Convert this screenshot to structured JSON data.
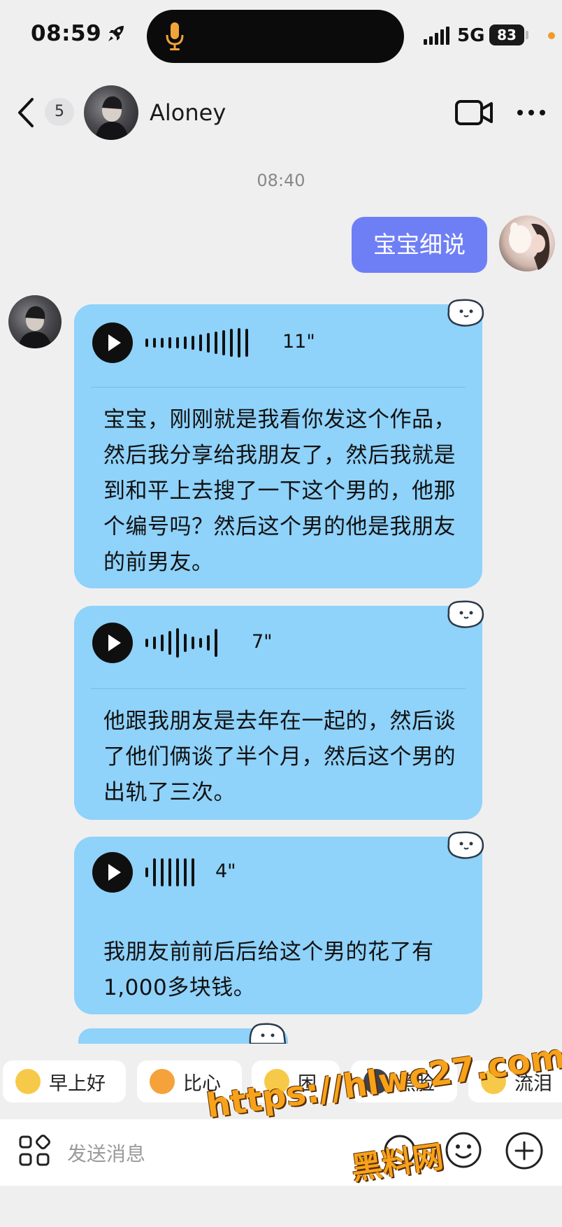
{
  "status_bar": {
    "time": "08:59",
    "network": "5G",
    "battery": "83",
    "icons": [
      "rocket-icon",
      "microphone-icon",
      "signal-icon"
    ]
  },
  "header": {
    "unread_count": "5",
    "contact_name": "Aloney",
    "icons": [
      "back-chevron-icon",
      "video-call-icon",
      "more-icon"
    ]
  },
  "conversation": {
    "timestamp": "08:40",
    "sent_message": "宝宝细说",
    "voice_messages": [
      {
        "duration": "11\"",
        "transcript": "宝宝，刚刚就是我看你发这个作品，然后我分享给我朋友了，然后我就是到和平上去搜了一下这个男的，他那个编号吗？然后这个男的他是我朋友的前男友。"
      },
      {
        "duration": "7\"",
        "transcript": "他跟我朋友是去年在一起的，然后谈了他们俩谈了半个月，然后这个男的出轨了三次。"
      },
      {
        "duration": "4\"",
        "transcript": "我朋友前前后后给这个男的花了有1,000多块钱。"
      }
    ]
  },
  "quick_replies": [
    {
      "label": "早上好",
      "icon": "sun-face-icon"
    },
    {
      "label": "比心",
      "icon": "heart-hands-icon"
    },
    {
      "label": "困",
      "icon": "sleepy-face-icon"
    },
    {
      "label": "黑脸",
      "icon": "dark-face-icon"
    },
    {
      "label": "流泪",
      "icon": "crying-face-icon"
    }
  ],
  "input_bar": {
    "placeholder": "发送消息",
    "icons": [
      "apps-grid-icon",
      "voice-input-icon",
      "emoji-icon",
      "plus-icon"
    ]
  },
  "watermark": {
    "url": "https://hlwc27.com",
    "site_name": "黑料网"
  },
  "colors": {
    "background": "#efeff0",
    "sent_bubble": "#6e7ff6",
    "received_bubble": "#8fd2fa",
    "watermark": "#f7a21b",
    "status_dot": "#f39a2b"
  }
}
